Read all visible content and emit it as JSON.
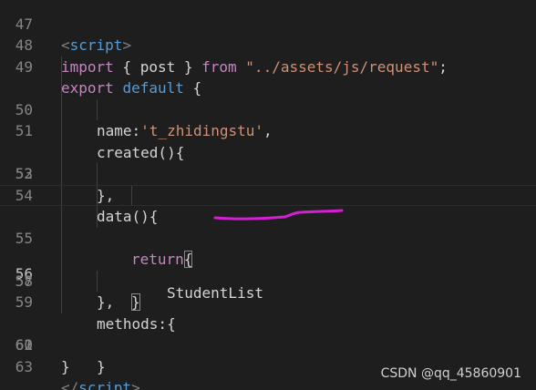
{
  "editor": {
    "lines": [
      {
        "number": "47",
        "t1": "<",
        "t2": "script",
        "t3": ">"
      },
      {
        "number": "48",
        "kw1": "import",
        "p1": " { post } ",
        "kw2": "from",
        "p2": " ",
        "s1": "\"../assets/js/request\"",
        "p3": ";"
      },
      {
        "number": "49",
        "kw1": "export",
        "p1": " ",
        "kw2": "default",
        "p2": " {"
      },
      {
        "number": "50",
        "p1": "name:",
        "s1": "'t_zhidingstu'",
        "p2": ","
      },
      {
        "number": "51",
        "p1": "created(){"
      },
      {
        "number": "52"
      },
      {
        "number": "53",
        "p1": "},"
      },
      {
        "number": "54",
        "p1": "data(){"
      },
      {
        "number": "55",
        "kw1": "return",
        "p1": "{"
      },
      {
        "number": "56",
        "p1": "StudentList"
      },
      {
        "number": "57",
        "p1": "}"
      },
      {
        "number": "58",
        "p1": "},"
      },
      {
        "number": "59",
        "p1": "methods:{"
      },
      {
        "number": "60"
      },
      {
        "number": "61",
        "p1": "}"
      },
      {
        "number": "62",
        "p1": "}"
      },
      {
        "number": "63",
        "t1": "</",
        "t2": "script",
        "t3": ">"
      }
    ]
  },
  "watermark": "CSDN @qq_45860901",
  "colors": {
    "background": "#1e1e1e",
    "keyword": "#c586c0",
    "builtin": "#569cd6",
    "string": "#ce9178",
    "annotation_stroke": "#d41fd4"
  }
}
